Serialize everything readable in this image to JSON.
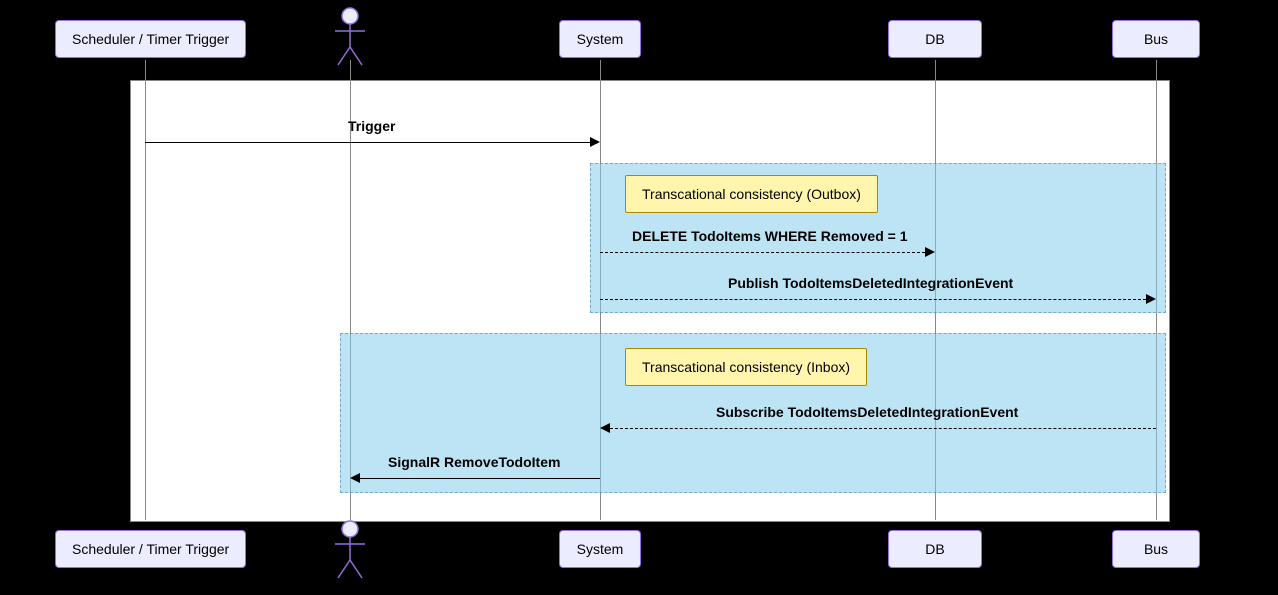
{
  "participants": {
    "p1": "Scheduler / Timer Trigger",
    "p2_actor": true,
    "p3": "System",
    "p4": "DB",
    "p5": "Bus"
  },
  "groups": {
    "g1": {
      "note": "Transcational consistency (Outbox)"
    },
    "g2": {
      "note": "Transcational consistency (Inbox)"
    }
  },
  "messages": {
    "m1": "Trigger",
    "m2": "DELETE TodoItems WHERE Removed = 1",
    "m3": "Publish TodoItemsDeletedIntegrationEvent",
    "m4": "Subscribe TodoItemsDeletedIntegrationEvent",
    "m5": "SignalR RemoveTodoItem"
  }
}
